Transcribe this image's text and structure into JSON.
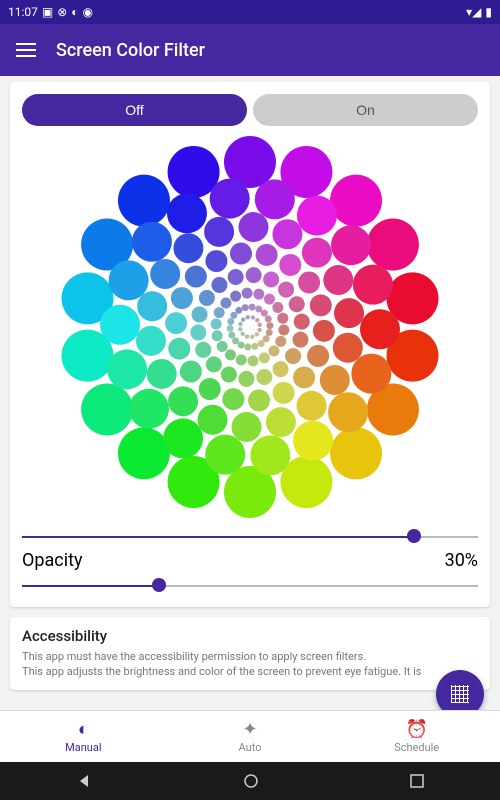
{
  "statusbar": {
    "time": "11:07"
  },
  "appbar": {
    "title": "Screen Color Filter"
  },
  "toggle": {
    "off_label": "Off",
    "on_label": "On",
    "selected": "off"
  },
  "hue_slider": {
    "value_pct": 86
  },
  "opacity": {
    "label": "Opacity",
    "value_text": "30%",
    "value_pct": 30
  },
  "accessibility": {
    "title": "Accessibility",
    "line1": "This app must have the accessibility permission to apply screen filters.",
    "line2": "This app adjusts the brightness and color of the screen to prevent eye fatigue. It is"
  },
  "bottomnav": {
    "items": [
      {
        "label": "Manual",
        "icon": "contrast-icon",
        "active": true
      },
      {
        "label": "Auto",
        "icon": "auto-icon",
        "active": false
      },
      {
        "label": "Schedule",
        "icon": "clock-icon",
        "active": false
      }
    ]
  },
  "colors": {
    "primary": "#4527a0"
  }
}
